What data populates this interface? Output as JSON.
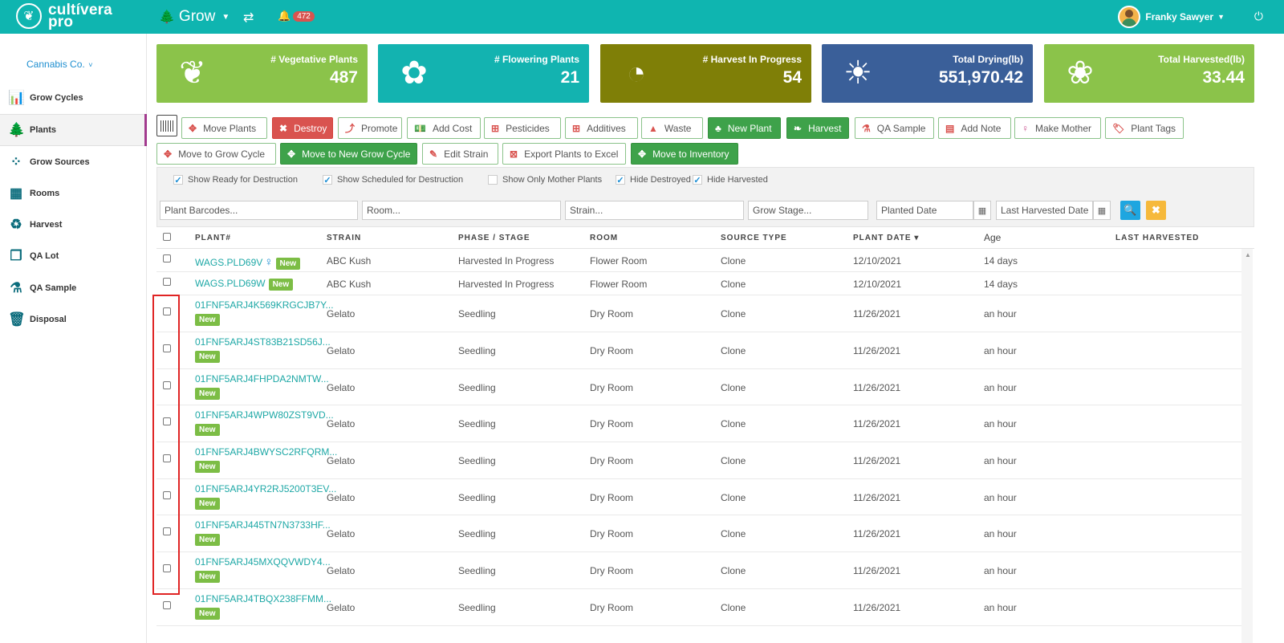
{
  "app": {
    "logo_line1": "cultívera",
    "logo_line2": "pro",
    "module": "Grow",
    "notifications": "472",
    "user_name": "Franky Sawyer"
  },
  "sidebar": {
    "company": "Cannabis Co.",
    "items": [
      {
        "label": "Grow Cycles",
        "icon": "bar-chart-icon",
        "glyph": "📊"
      },
      {
        "label": "Plants",
        "icon": "tree-icon",
        "glyph": "🌲"
      },
      {
        "label": "Grow Sources",
        "icon": "dots-icon",
        "glyph": "⁘"
      },
      {
        "label": "Rooms",
        "icon": "grid-icon",
        "glyph": "▦"
      },
      {
        "label": "Harvest",
        "icon": "recycle-icon",
        "glyph": "♻"
      },
      {
        "label": "QA Lot",
        "icon": "squares-icon",
        "glyph": "❐"
      },
      {
        "label": "QA Sample",
        "icon": "flask-icon",
        "glyph": "⚗"
      },
      {
        "label": "Disposal",
        "icon": "trash-icon",
        "glyph": "🗑"
      }
    ]
  },
  "cards": [
    {
      "label": "# Vegetative Plants",
      "value": "487",
      "color": "#8bc34a",
      "icon": "plant-icon",
      "glyph": "❦"
    },
    {
      "label": "# Flowering Plants",
      "value": "21",
      "color": "#13b3b0",
      "icon": "flower-icon",
      "glyph": "✿"
    },
    {
      "label": "# Harvest In Progress",
      "value": "54",
      "color": "#7f7f07",
      "icon": "timer-icon",
      "glyph": "◔"
    },
    {
      "label": "Total Drying(lb)",
      "value": "551,970.42",
      "color": "#3a5f99",
      "icon": "lamp-icon",
      "glyph": "☀"
    },
    {
      "label": "Total Harvested(lb)",
      "value": "33.44",
      "color": "#8bc34a",
      "icon": "flower-outline-icon",
      "glyph": "❀"
    }
  ],
  "actions": {
    "move_plants": "Move Plants",
    "destroy": "Destroy",
    "promote": "Promote",
    "add_cost": "Add Cost",
    "pesticides": "Pesticides",
    "additives": "Additives",
    "waste": "Waste",
    "new_plant": "New Plant",
    "harvest": "Harvest",
    "qa_sample": "QA Sample",
    "add_note": "Add Note",
    "make_mother": "Make Mother",
    "plant_tags": "Plant Tags",
    "move_to_grow_cycle": "Move to Grow Cycle",
    "move_to_new_grow_cycle": "Move to New Grow Cycle",
    "edit_strain": "Edit Strain",
    "export_plants": "Export Plants to Excel",
    "move_to_inventory": "Move to Inventory"
  },
  "filters": {
    "checks": [
      {
        "label": "Show Ready for Destruction",
        "checked": true
      },
      {
        "label": "Show Scheduled for Destruction",
        "checked": true
      },
      {
        "label": "Show Only Mother Plants",
        "checked": false
      },
      {
        "label": "Hide Destroyed",
        "checked": true
      },
      {
        "label": "Hide Harvested",
        "checked": true
      }
    ],
    "barcodes_ph": "Plant Barcodes...",
    "room_ph": "Room...",
    "strain_ph": "Strain...",
    "stage_ph": "Grow Stage...",
    "planted_ph": "Planted Date",
    "harvested_ph": "Last Harvested Date"
  },
  "table": {
    "headers": {
      "plant": "PLANT#",
      "strain": "STRAIN",
      "phase": "PHASE / STAGE",
      "room": "ROOM",
      "source": "SOURCE TYPE",
      "plant_date": "PLANT DATE ▾",
      "age": "Age",
      "last_harvested": "LAST HARVESTED"
    },
    "badge": "New",
    "rows": [
      {
        "plant": "WAGS.PLD69V",
        "strain": "ABC Kush",
        "phase": "Harvested In Progress",
        "room": "Flower Room",
        "source": "Clone",
        "date": "12/10/2021",
        "age": "14 days"
      },
      {
        "plant": "WAGS.PLD69W",
        "strain": "ABC Kush",
        "phase": "Harvested In Progress",
        "room": "Flower Room",
        "source": "Clone",
        "date": "12/10/2021",
        "age": "14 days"
      },
      {
        "plant": "01FNF5ARJ4K569KRGCJB7Y...",
        "strain": "Gelato",
        "phase": "Seedling",
        "room": "Dry Room",
        "source": "Clone",
        "date": "11/26/2021",
        "age": "an hour"
      },
      {
        "plant": "01FNF5ARJ4ST83B21SD56J...",
        "strain": "Gelato",
        "phase": "Seedling",
        "room": "Dry Room",
        "source": "Clone",
        "date": "11/26/2021",
        "age": "an hour"
      },
      {
        "plant": "01FNF5ARJ4FHPDA2NMTW...",
        "strain": "Gelato",
        "phase": "Seedling",
        "room": "Dry Room",
        "source": "Clone",
        "date": "11/26/2021",
        "age": "an hour"
      },
      {
        "plant": "01FNF5ARJ4WPW80ZST9VD...",
        "strain": "Gelato",
        "phase": "Seedling",
        "room": "Dry Room",
        "source": "Clone",
        "date": "11/26/2021",
        "age": "an hour"
      },
      {
        "plant": "01FNF5ARJ4BWYSC2RFQRM...",
        "strain": "Gelato",
        "phase": "Seedling",
        "room": "Dry Room",
        "source": "Clone",
        "date": "11/26/2021",
        "age": "an hour"
      },
      {
        "plant": "01FNF5ARJ4YR2RJ5200T3EV...",
        "strain": "Gelato",
        "phase": "Seedling",
        "room": "Dry Room",
        "source": "Clone",
        "date": "11/26/2021",
        "age": "an hour"
      },
      {
        "plant": "01FNF5ARJ445TN7N3733HF...",
        "strain": "Gelato",
        "phase": "Seedling",
        "room": "Dry Room",
        "source": "Clone",
        "date": "11/26/2021",
        "age": "an hour"
      },
      {
        "plant": "01FNF5ARJ45MXQQVWDY4...",
        "strain": "Gelato",
        "phase": "Seedling",
        "room": "Dry Room",
        "source": "Clone",
        "date": "11/26/2021",
        "age": "an hour"
      },
      {
        "plant": "01FNF5ARJ4TBQX238FFMM...",
        "strain": "Gelato",
        "phase": "Seedling",
        "room": "Dry Room",
        "source": "Clone",
        "date": "11/26/2021",
        "age": "an hour"
      }
    ]
  }
}
